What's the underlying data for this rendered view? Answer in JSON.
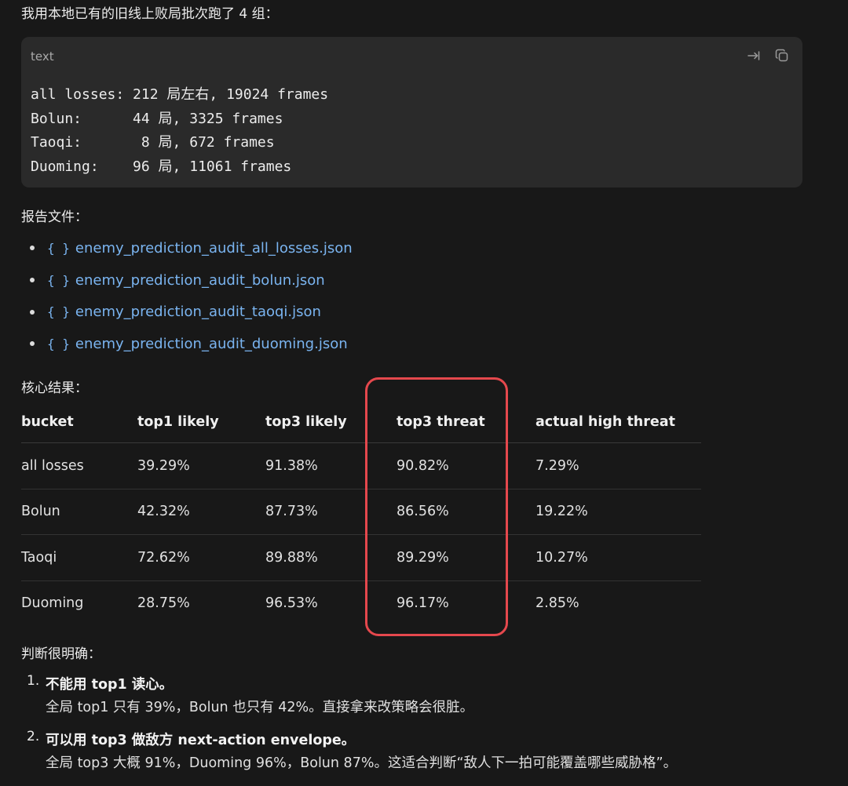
{
  "intro": "我用本地已有的旧线上败局批次跑了 4 组：",
  "code_block": {
    "language": "text",
    "lines": [
      "all losses: 212 局左右, 19024 frames",
      "Bolun:      44 局, 3325 frames",
      "Taoqi:       8 局, 672 frames",
      "Duoming:    96 局, 11061 frames"
    ]
  },
  "report_label": "报告文件：",
  "files": [
    "enemy_prediction_audit_all_losses.json",
    "enemy_prediction_audit_bolun.json",
    "enemy_prediction_audit_taoqi.json",
    "enemy_prediction_audit_duoming.json"
  ],
  "results_label": "核心结果：",
  "table": {
    "headers": [
      "bucket",
      "top1 likely",
      "top3 likely",
      "top3 threat",
      "actual high threat"
    ],
    "rows": [
      [
        "all losses",
        "39.29%",
        "91.38%",
        "90.82%",
        "7.29%"
      ],
      [
        "Bolun",
        "42.32%",
        "87.73%",
        "86.56%",
        "19.22%"
      ],
      [
        "Taoqi",
        "72.62%",
        "89.88%",
        "89.29%",
        "10.27%"
      ],
      [
        "Duoming",
        "28.75%",
        "96.53%",
        "96.17%",
        "2.85%"
      ]
    ]
  },
  "judgement_label": "判断很明确：",
  "conclusions": [
    {
      "num": "1.",
      "head": "不能用 top1 读心。",
      "body": "全局 top1 只有 39%，Bolun 也只有 42%。直接拿来改策略会很脏。"
    },
    {
      "num": "2.",
      "head": "可以用 top3 做敌方 next-action envelope。",
      "body": "全局 top3 大概 91%，Duoming 96%，Bolun 87%。这适合判断“敌人下一拍可能覆盖哪些威胁格”。"
    }
  ],
  "colors": {
    "link": "#7ab4f0",
    "highlight_border": "#e5484d",
    "background": "#181818",
    "code_bg": "#2a2a2a"
  },
  "icons": {
    "wrap": "wrap-icon",
    "copy": "copy-icon"
  }
}
